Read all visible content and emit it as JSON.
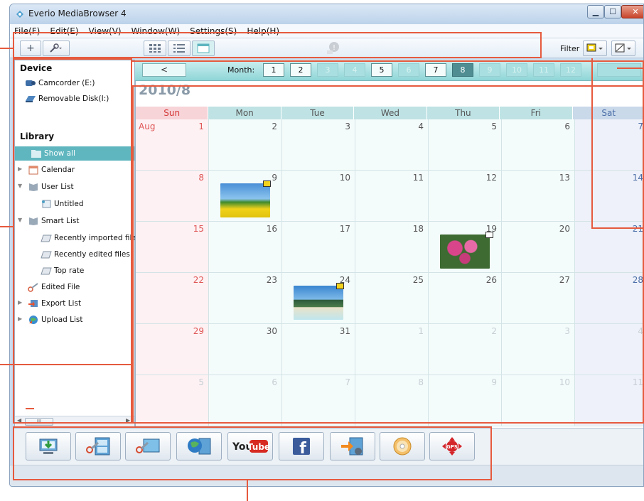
{
  "window": {
    "title": "Everio MediaBrowser 4"
  },
  "menu": [
    "File(F)",
    "Edit(E)",
    "View(V)",
    "Window(W)",
    "Settings(S)",
    "Help(H)"
  ],
  "toolbar": {
    "filter_label": "Filter"
  },
  "sidebar": {
    "device_title": "Device",
    "devices": [
      "Camcorder (E:)",
      "Removable Disk(I:)"
    ],
    "library_title": "Library",
    "items": [
      "Show all",
      "Calendar",
      "User List",
      "Untitled",
      "Smart List",
      "Recently imported files",
      "Recently edited files",
      "Top rate",
      "Edited File",
      "Export List",
      "Upload List"
    ],
    "scroll_label": "III"
  },
  "monthbar": {
    "prev_label": "<",
    "month_label": "Month:",
    "months": [
      "1",
      "2",
      "3",
      "4",
      "5",
      "6",
      "7",
      "8",
      "9",
      "10",
      "11",
      "12"
    ],
    "enabled": [
      1,
      2,
      5,
      7
    ],
    "selected": 8
  },
  "calendar": {
    "year_month": "2010/8",
    "days_of_week": [
      "Sun",
      "Mon",
      "Tue",
      "Wed",
      "Thu",
      "Fri",
      "Sat"
    ],
    "aug_label": "Aug",
    "weeks": [
      [
        "1",
        "2",
        "3",
        "4",
        "5",
        "6",
        "7"
      ],
      [
        "8",
        "9",
        "10",
        "11",
        "12",
        "13",
        "14"
      ],
      [
        "15",
        "16",
        "17",
        "18",
        "19",
        "20",
        "21"
      ],
      [
        "22",
        "23",
        "24",
        "25",
        "26",
        "27",
        "28"
      ],
      [
        "29",
        "30",
        "31",
        "1",
        "2",
        "3",
        "4"
      ],
      [
        "5",
        "6",
        "7",
        "8",
        "9",
        "10",
        "11"
      ]
    ]
  },
  "actions": [
    "import",
    "edit-video",
    "edit-photo",
    "web",
    "youtube",
    "facebook",
    "export",
    "disc",
    "gps"
  ],
  "action_text": {
    "youtube_you": "You",
    "youtube_tube": "Tube",
    "facebook": "f",
    "gps": "GPS"
  },
  "colors": {
    "accent": "#5fb6bf",
    "callout": "#e65a3e",
    "sunday": "#e05656",
    "saturday": "#4b6ea8"
  }
}
